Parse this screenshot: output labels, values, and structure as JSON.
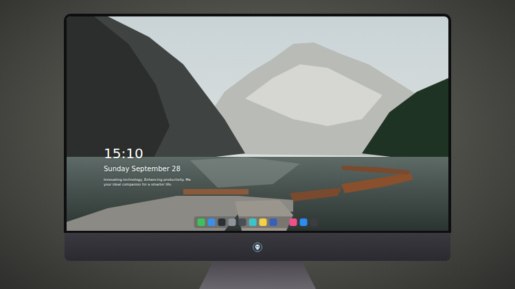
{
  "lock_screen": {
    "time": "15:10",
    "date": "Sunday September 28",
    "tagline": [
      "Innovating technology, Enhancing productivity. Ma",
      "your ideal companion for a smarter life."
    ]
  },
  "dock": {
    "items": [
      {
        "app": "messages",
        "color": "#3fc25a"
      },
      {
        "app": "files",
        "color": "#3a8fe8"
      },
      {
        "app": "browser",
        "color": "#2b2f38"
      },
      {
        "app": "settings",
        "color": "#8f949c"
      },
      {
        "app": "video",
        "color": "#4a4f57"
      },
      {
        "app": "maps",
        "color": "#3cc4c8"
      },
      {
        "app": "notes",
        "color": "#f3d04a"
      },
      {
        "app": "photos",
        "color": "#3a5fb8"
      },
      {
        "app": "music",
        "color": "#f0508a"
      },
      {
        "app": "store",
        "color": "#2d8cf0"
      },
      {
        "app": "camera",
        "color": "#3b3d42"
      }
    ]
  }
}
